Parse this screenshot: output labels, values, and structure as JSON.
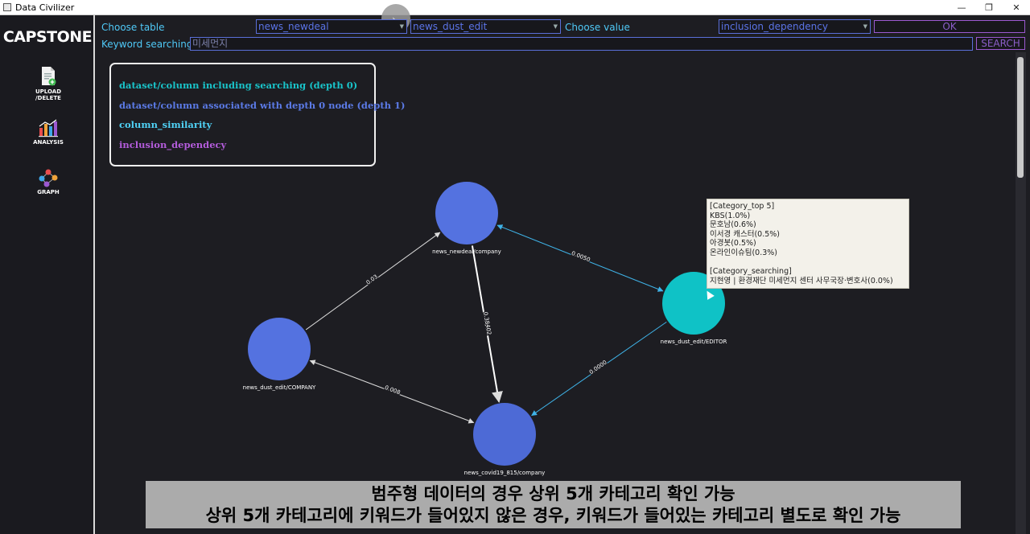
{
  "window": {
    "title": "Data Civilizer"
  },
  "sidebar": {
    "brand": "CAPSTONE",
    "items": [
      {
        "label": "UPLOAD /DELETE",
        "icon": "upload-document-icon"
      },
      {
        "label": "ANALYSIS",
        "icon": "bar-chart-icon"
      },
      {
        "label": "GRAPH",
        "icon": "graph-network-icon"
      }
    ]
  },
  "toolbar": {
    "choose_table_label": "Choose table",
    "table1_value": "news_newdeal",
    "table2_value": "news_dust_edit",
    "choose_value_label": "Choose value",
    "value_select": "inclusion_dependency",
    "ok_label": "OK",
    "keyword_label": "Keyword searching",
    "keyword_value": "미세먼지",
    "search_label": "SEARCH"
  },
  "legend": {
    "items": [
      {
        "label": "dataset/column including searching (depth 0)",
        "color": "#19c3c9"
      },
      {
        "label": "dataset/column associated with depth 0 node (depth 1)",
        "color": "#5b7ae6"
      },
      {
        "label": "column_similarity",
        "color": "#4fd1f5"
      },
      {
        "label": "inclusion_dependecy",
        "color": "#b35cdb"
      }
    ]
  },
  "graph": {
    "nodes": [
      {
        "id": "n1",
        "label": "news_newdeal/company",
        "color": "#5472e0"
      },
      {
        "id": "n2",
        "label": "news_dust_edit/COMPANY",
        "color": "#5472e0"
      },
      {
        "id": "n3",
        "label": "news_covid19_815/company",
        "color": "#4d6ad6"
      },
      {
        "id": "n4",
        "label": "news_dust_edit/EDITOR",
        "color": "#0fc2c6"
      }
    ],
    "edges": [
      {
        "from": "n1",
        "to": "n2",
        "label": "0.03"
      },
      {
        "from": "n1",
        "to": "n3",
        "label": "0.38402"
      },
      {
        "from": "n2",
        "to": "n3",
        "label": "0.008"
      },
      {
        "from": "n4",
        "to": "n1",
        "label": "0.0050"
      },
      {
        "from": "n4",
        "to": "n3",
        "label": "0.0000"
      }
    ]
  },
  "tooltip": {
    "lines": [
      "[Category_top 5]",
      "KBS(1.0%)",
      "문호남(0.6%)",
      "이서경 캐스터(0.5%)",
      "아경봇(0.5%)",
      "온라인이슈팀(0.3%)",
      "",
      "[Category_searching]",
      "지현영 | 환경재단 미세먼지 센터 사무국장·변호사(0.0%)"
    ]
  },
  "subtitle": {
    "line1": "범주형 데이터의 경우 상위 5개 카테고리 확인 가능",
    "line2": "상위 5개 카테고리에 키워드가 들어있지 않은 경우, 키워드가 들어있는 카테고리 별도로 확인 가능"
  }
}
